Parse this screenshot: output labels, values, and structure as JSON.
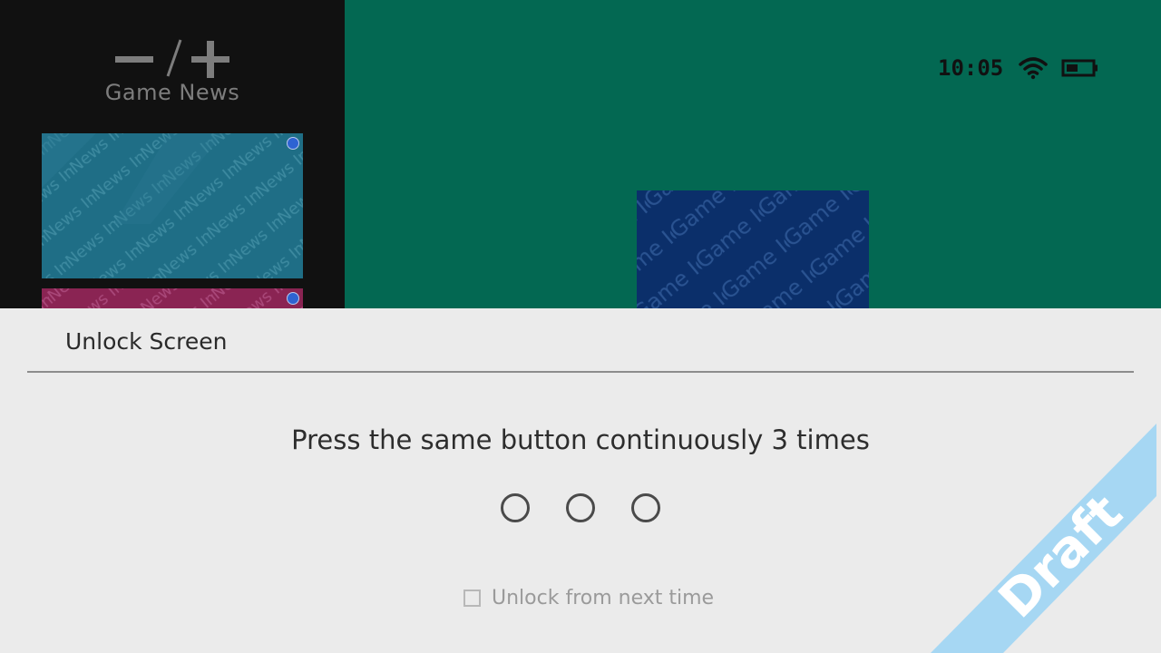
{
  "news_panel": {
    "header_icons": [
      "minus-icon",
      "plus-icon"
    ],
    "title": "Game News",
    "cards": [
      {
        "watermark": "News Image",
        "color": "#1f6e86"
      },
      {
        "watermark": "News Image",
        "color": "#8a2453"
      }
    ]
  },
  "game_icon": {
    "watermark": "Game Icon",
    "color": "#0b2f6a"
  },
  "status_bar": {
    "time": "10:05",
    "icons": [
      "wifi-icon",
      "battery-icon"
    ]
  },
  "dialog": {
    "title": "Unlock Screen",
    "instruction": "Press the same button continuously 3 times",
    "press_indicators": 3,
    "checkbox": {
      "label": "Unlock from next time",
      "checked": false
    }
  },
  "watermark": {
    "label": "Draft",
    "color": "#a6d7f3"
  },
  "colors": {
    "background_top": "#036852",
    "news_panel_bg": "#111111",
    "dialog_bg": "#ebebeb"
  }
}
